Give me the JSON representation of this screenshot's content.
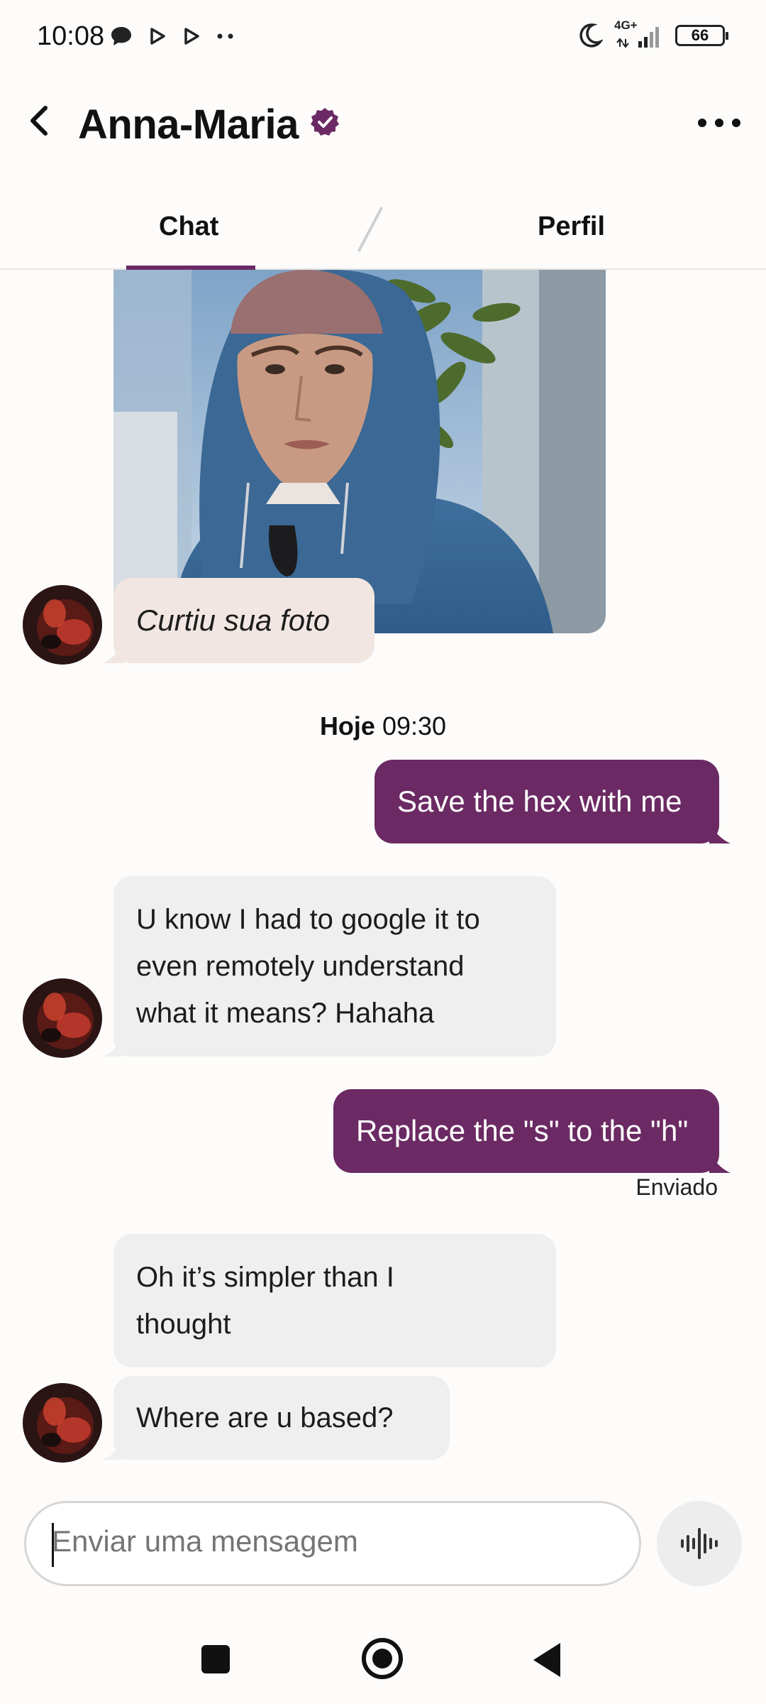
{
  "status_bar": {
    "time": "10:08",
    "network": "4G+",
    "battery": "66",
    "icons": [
      "chat-bubble-icon",
      "play-icon",
      "play-icon",
      "more-dots-icon",
      "moon-icon",
      "signal-icon"
    ]
  },
  "header": {
    "title": "Anna-Maria",
    "verified_icon": "verified-badge-icon",
    "back_icon": "chevron-left-icon",
    "more_icon": "more-horizontal-icon"
  },
  "tabs": [
    {
      "label": "Chat",
      "active": true
    },
    {
      "label": "Perfil",
      "active": false
    }
  ],
  "messages": {
    "liked_photo": "Curtiu sua foto",
    "date_separator": {
      "day": "Hoje",
      "time": "09:30"
    },
    "out_1": "Save the hex with me",
    "in_1": [
      "U know I had to google it to",
      "even remotely understand",
      "what it means? Hahaha"
    ],
    "out_2": "Replace the \"s\" to the \"h\"",
    "sent_status": "Enviado",
    "in_2": [
      "Oh it’s simpler than I",
      "thought"
    ],
    "in_3": "Where are u based?"
  },
  "composer": {
    "placeholder": "Enviar uma mensagem",
    "voice_icon": "waveform-icon"
  },
  "colors": {
    "accent": "#6b2a63",
    "incoming_bubble": "#efefef",
    "liked_bubble": "#f2e6e2"
  }
}
